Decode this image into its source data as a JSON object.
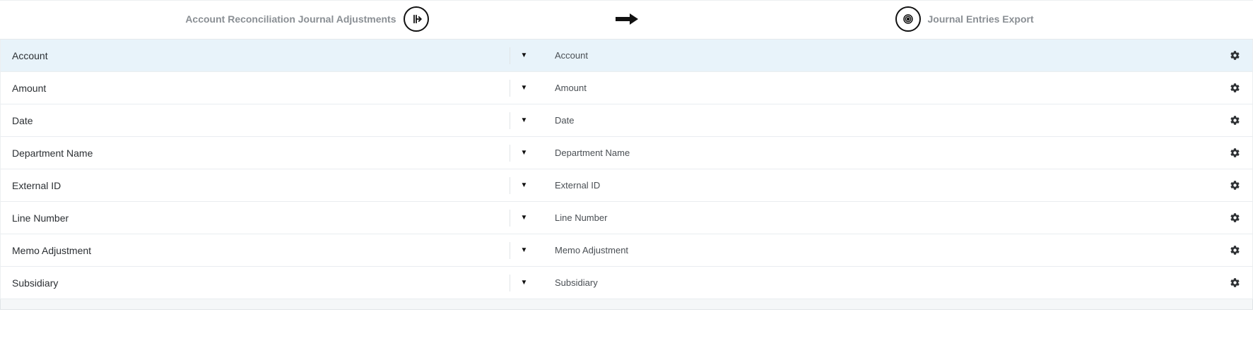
{
  "header": {
    "source_label": "Account Reconciliation Journal Adjustments",
    "target_label": "Journal Entries Export"
  },
  "rows": [
    {
      "source": "Account",
      "target": "Account",
      "selected": true
    },
    {
      "source": "Amount",
      "target": "Amount",
      "selected": false
    },
    {
      "source": "Date",
      "target": "Date",
      "selected": false
    },
    {
      "source": "Department Name",
      "target": "Department Name",
      "selected": false
    },
    {
      "source": "External ID",
      "target": "External ID",
      "selected": false
    },
    {
      "source": "Line Number",
      "target": "Line Number",
      "selected": false
    },
    {
      "source": "Memo Adjustment",
      "target": "Memo Adjustment",
      "selected": false
    },
    {
      "source": "Subsidiary",
      "target": "Subsidiary",
      "selected": false
    }
  ]
}
